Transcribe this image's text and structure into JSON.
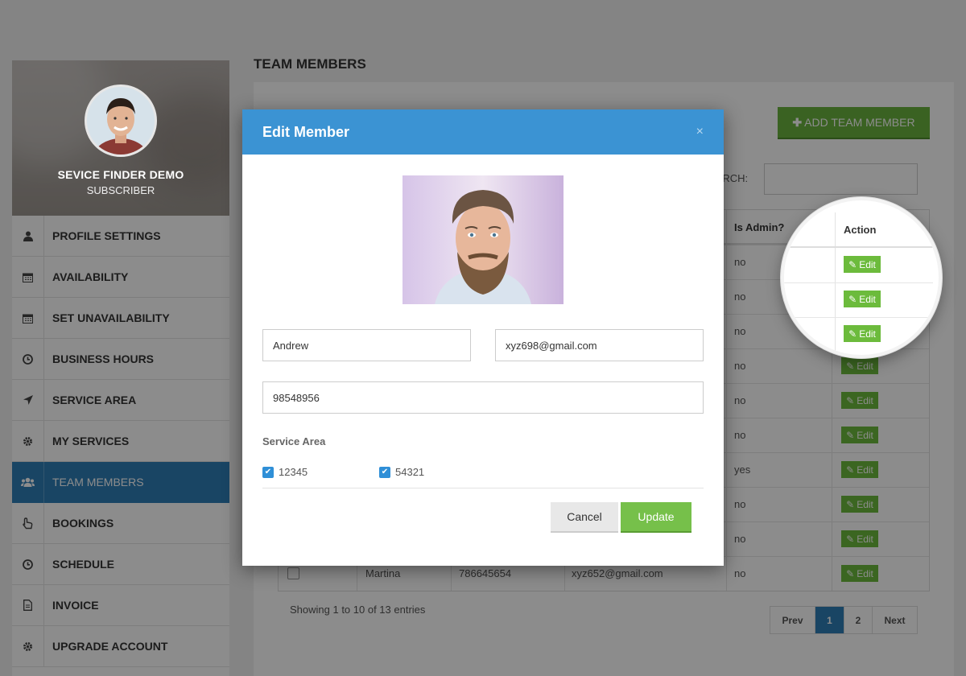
{
  "sidebar": {
    "profile_name": "SEVICE FINDER DEMO",
    "profile_role": "SUBSCRIBER",
    "items": [
      {
        "label": "PROFILE SETTINGS",
        "icon": "user-icon"
      },
      {
        "label": "AVAILABILITY",
        "icon": "calendar-icon"
      },
      {
        "label": "SET UNAVAILABILITY",
        "icon": "calendar-icon"
      },
      {
        "label": "BUSINESS HOURS",
        "icon": "clock-icon"
      },
      {
        "label": "SERVICE AREA",
        "icon": "location-arrow-icon"
      },
      {
        "label": "MY SERVICES",
        "icon": "gear-icon"
      },
      {
        "label": "TEAM MEMBERS",
        "icon": "users-icon",
        "active": true
      },
      {
        "label": "BOOKINGS",
        "icon": "hand-pointer-icon"
      },
      {
        "label": "SCHEDULE",
        "icon": "clock-icon"
      },
      {
        "label": "INVOICE",
        "icon": "file-icon"
      },
      {
        "label": "UPGRADE ACCOUNT",
        "icon": "gear-icon"
      }
    ]
  },
  "main": {
    "page_title": "TEAM MEMBERS",
    "add_button": "ADD TEAM MEMBER",
    "search_label": "EARCH:",
    "search_value": "",
    "table": {
      "headers": {
        "is_admin": "Is Admin?",
        "action": "Action"
      },
      "rows": [
        {
          "is_admin": "no",
          "action": "Edit"
        },
        {
          "is_admin": "no",
          "action": "Edit"
        },
        {
          "is_admin": "no",
          "action": "Edit"
        },
        {
          "is_admin": "no",
          "action": "Edit"
        },
        {
          "is_admin": "no",
          "action": "Edit"
        },
        {
          "is_admin": "no",
          "action": "Edit"
        },
        {
          "is_admin": "yes",
          "action": "Edit"
        },
        {
          "is_admin": "no",
          "action": "Edit"
        },
        {
          "is_admin": "no",
          "action": "Edit"
        },
        {
          "name": "Martina",
          "phone": "786645654",
          "email": "xyz652@gmail.com",
          "is_admin": "no",
          "action": "Edit"
        }
      ]
    },
    "showing": "Showing 1 to 10 of 13 entries",
    "pagination": {
      "prev": "Prev",
      "pages": [
        "1",
        "2"
      ],
      "active_page": "1",
      "next": "Next"
    }
  },
  "modal": {
    "title": "Edit Member",
    "close": "×",
    "name_value": "Andrew",
    "email_value": "xyz698@gmail.com",
    "phone_value": "98548956",
    "service_area_title": "Service Area",
    "service_areas": [
      {
        "label": "12345",
        "checked": true
      },
      {
        "label": "54321",
        "checked": true
      }
    ],
    "cancel_label": "Cancel",
    "update_label": "Update"
  },
  "colors": {
    "primary_blue": "#3b93d3",
    "active_nav": "#2f7fb7",
    "success_green": "#6ab33f"
  }
}
